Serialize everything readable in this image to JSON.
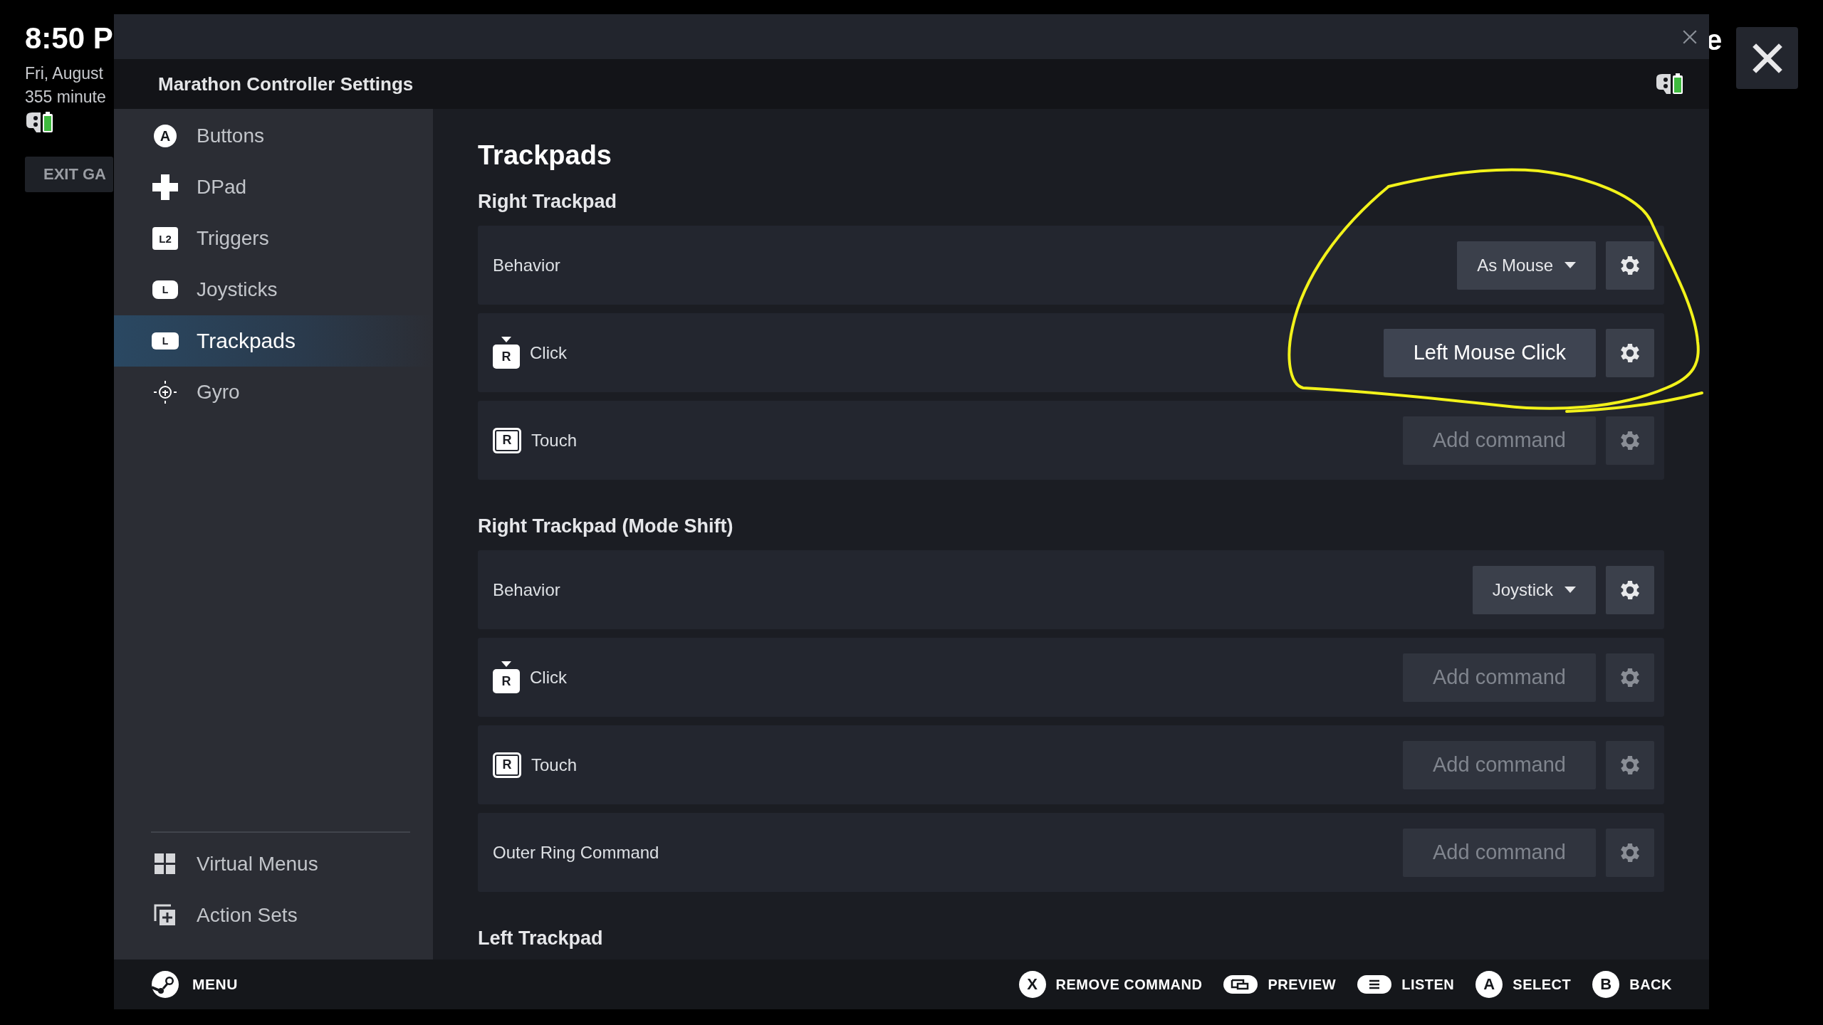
{
  "background": {
    "time": "8:50 P",
    "date": "Fri, August",
    "battery_text": "355 minute",
    "exit_button": "EXIT GA",
    "title_fragment": "e"
  },
  "modal": {
    "title": "Marathon Controller Settings"
  },
  "sidebar": {
    "items": [
      {
        "label": "Buttons",
        "kind": "face",
        "glyph": "A",
        "selected": false
      },
      {
        "label": "DPad",
        "kind": "dpad",
        "selected": false
      },
      {
        "label": "Triggers",
        "kind": "trigger",
        "glyph": "L2",
        "selected": false
      },
      {
        "label": "Joysticks",
        "kind": "stick",
        "glyph": "L",
        "selected": false
      },
      {
        "label": "Trackpads",
        "kind": "pad",
        "glyph": "L",
        "selected": true
      },
      {
        "label": "Gyro",
        "kind": "gyro",
        "selected": false
      }
    ],
    "bottom_items": [
      {
        "label": "Virtual Menus",
        "kind": "grid",
        "selected": false
      },
      {
        "label": "Action Sets",
        "kind": "sets",
        "selected": false
      }
    ]
  },
  "page_title": "Trackpads",
  "sections": [
    {
      "title": "Right Trackpad",
      "rows": [
        {
          "label": "Behavior",
          "kind": "dropdown",
          "value": "As Mouse"
        },
        {
          "label": "Click",
          "kind": "click",
          "glyph": "R",
          "value": "Left Mouse Click",
          "assigned": true
        },
        {
          "label": "Touch",
          "kind": "touch",
          "glyph": "R",
          "value": "Add command",
          "assigned": false
        }
      ]
    },
    {
      "title": "Right Trackpad (Mode Shift)",
      "rows": [
        {
          "label": "Behavior",
          "kind": "dropdown",
          "value": "Joystick"
        },
        {
          "label": "Click",
          "kind": "click",
          "glyph": "R",
          "value": "Add command",
          "assigned": false
        },
        {
          "label": "Touch",
          "kind": "touch",
          "glyph": "R",
          "value": "Add command",
          "assigned": false
        },
        {
          "label": "Outer Ring Command",
          "kind": "command",
          "value": "Add command",
          "assigned": false
        }
      ]
    },
    {
      "title": "Left Trackpad"
    }
  ],
  "footer": {
    "menu": "MENU",
    "hints": [
      {
        "kind": "letter",
        "glyph": "X",
        "label": "REMOVE COMMAND"
      },
      {
        "kind": "preview",
        "label": "PREVIEW"
      },
      {
        "kind": "listen",
        "label": "LISTEN"
      },
      {
        "kind": "letter",
        "glyph": "A",
        "label": "SELECT"
      },
      {
        "kind": "letter",
        "glyph": "B",
        "label": "BACK"
      }
    ]
  }
}
